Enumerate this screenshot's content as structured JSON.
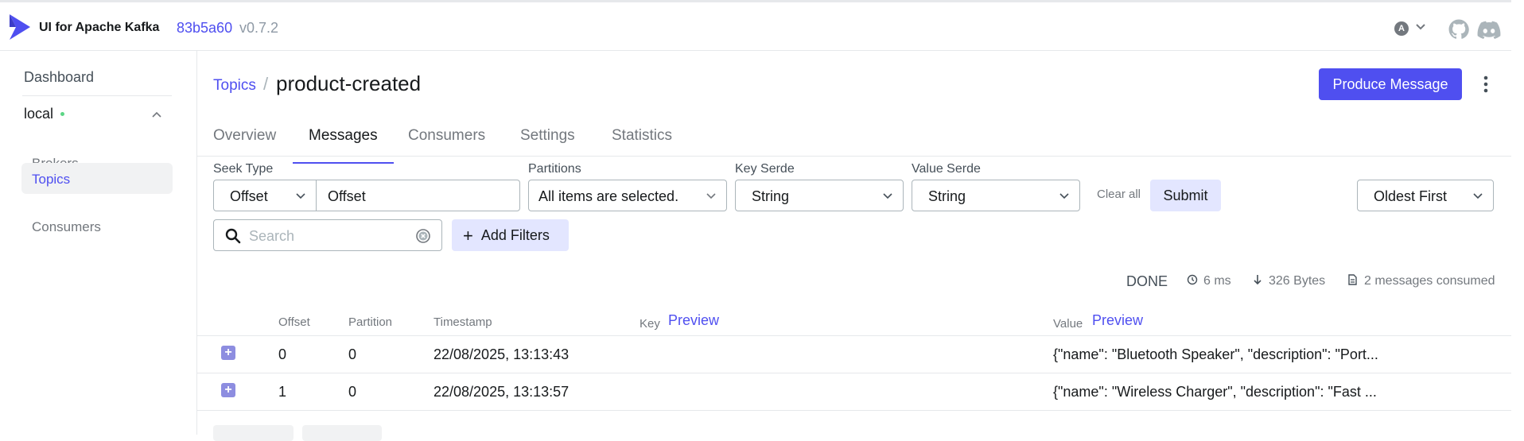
{
  "header": {
    "brand": "UI for Apache Kafka",
    "version_hash": "83b5a60",
    "version": "v0.7.2",
    "avatar_letter": "A"
  },
  "sidebar": {
    "dashboard": "Dashboard",
    "cluster": "local",
    "cluster_status_color": "#5cd685",
    "items": [
      {
        "label": "Brokers"
      },
      {
        "label": "Topics"
      },
      {
        "label": "Consumers"
      }
    ]
  },
  "page": {
    "breadcrumb": "Topics",
    "title": "product-created",
    "produce_label": "Produce Message"
  },
  "tabs": [
    "Overview",
    "Messages",
    "Consumers",
    "Settings",
    "Statistics"
  ],
  "filters": {
    "seek_type_label": "Seek Type",
    "seek_type": "Offset",
    "offset_placeholder": "Offset",
    "partitions_label": "Partitions",
    "partitions": "All items are selected.",
    "key_serde_label": "Key Serde",
    "key_serde": "String",
    "value_serde_label": "Value Serde",
    "value_serde": "String",
    "clear_all": "Clear all",
    "submit": "Submit",
    "sort": "Oldest First",
    "search_placeholder": "Search",
    "add_filters": "Add Filters"
  },
  "meta": {
    "status": "DONE",
    "elapsed": "6 ms",
    "bytes": "326 Bytes",
    "consumed": "2 messages consumed"
  },
  "table": {
    "headers": {
      "offset": "Offset",
      "partition": "Partition",
      "timestamp": "Timestamp",
      "key": "Key",
      "value": "Value",
      "preview": "Preview"
    },
    "rows": [
      {
        "offset": "0",
        "partition": "0",
        "timestamp": "22/08/2025, 13:13:43",
        "value": "{\"name\": \"Bluetooth Speaker\", \"description\": \"Port..."
      },
      {
        "offset": "1",
        "partition": "0",
        "timestamp": "22/08/2025, 13:13:57",
        "value": "{\"name\": \"Wireless Charger\", \"description\": \"Fast ..."
      }
    ]
  },
  "colors": {
    "accent": "#4f4ff0",
    "accent_light": "#e3e6ff"
  }
}
